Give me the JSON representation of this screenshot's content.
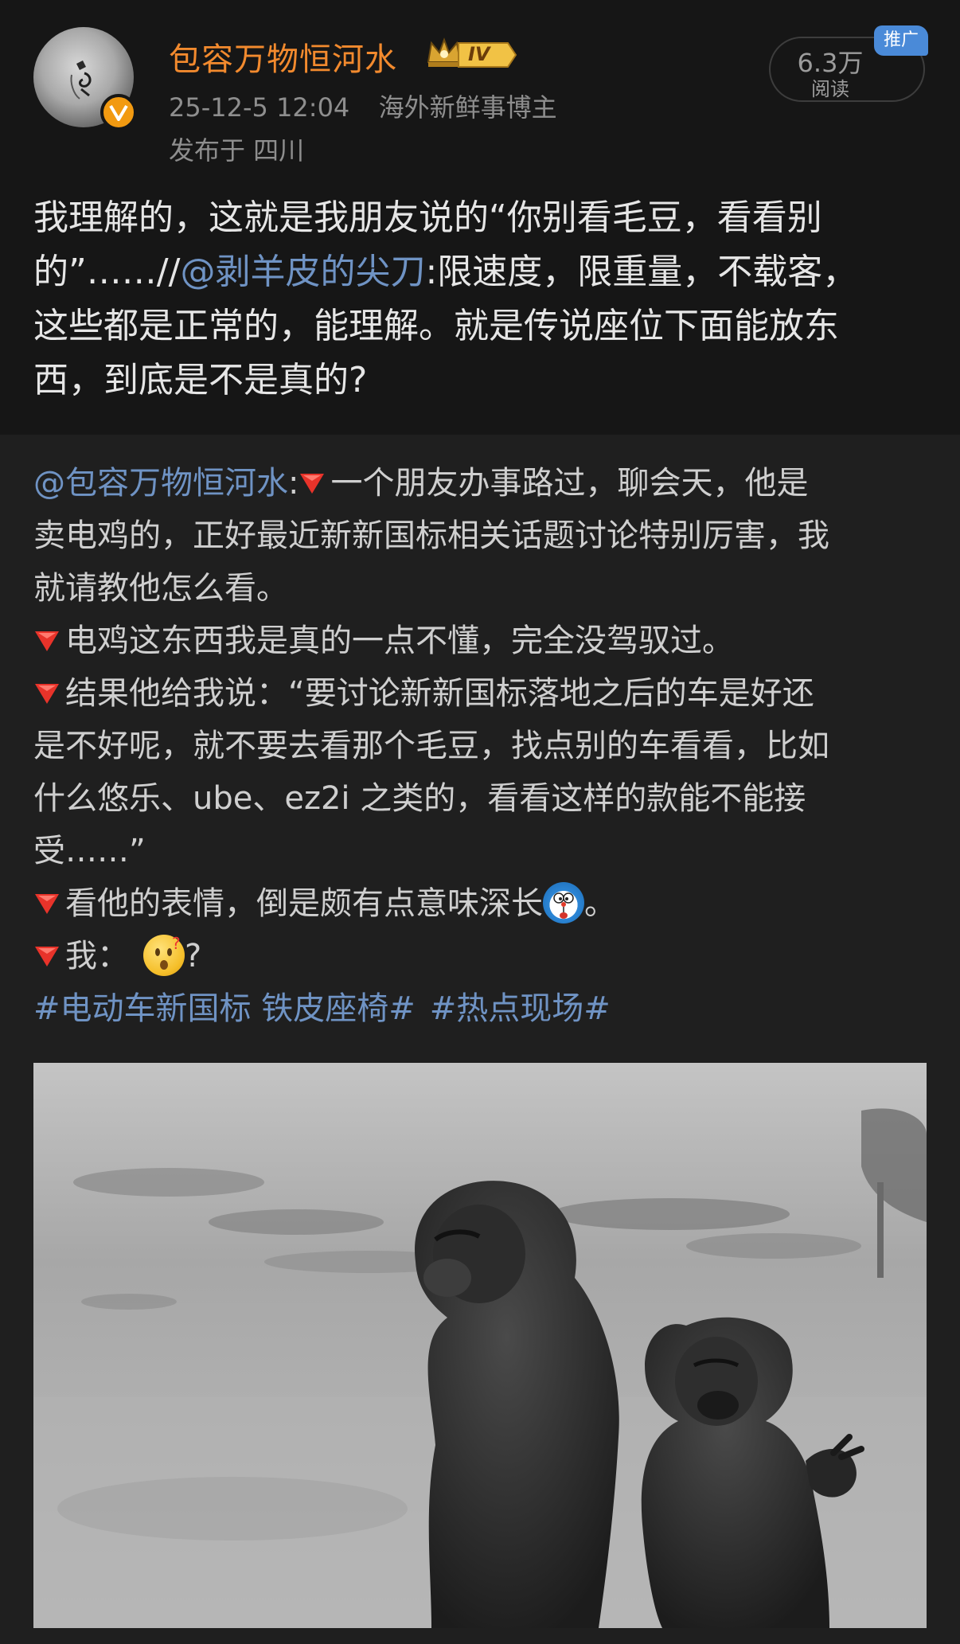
{
  "header": {
    "username": "包容万物恒河水",
    "level_badge": "IV",
    "timestamp": "25-12-5 12:04",
    "author_tag": "海外新鲜事博主",
    "location": "发布于 四川",
    "read_count": "6.3万",
    "read_label": "阅读",
    "ad_tag": "推广"
  },
  "post": {
    "line1": "我理解的，这就是我朋友说的“你别看毛豆，看看别",
    "line2_prefix": "的”……//",
    "line2_mention": "@剥羊皮的尖刀",
    "line2_suffix": ":限速度，限重量，不载客，",
    "line3": "这些都是正常的，能理解。就是传说座位下面能放东",
    "line4": "西，到底是不是真的?"
  },
  "repost": {
    "mention": "@包容万物恒河水",
    "colon": ":",
    "line1_text": "一个朋友办事路过，聊会天，他是",
    "line2": "卖电鸡的，正好最近新新国标相关话题讨论特别厉害，我",
    "line3": "就请教他怎么看。",
    "line4": "电鸡这东西我是真的一点不懂，完全没驾驭过。",
    "line5": "结果他给我说：“要讨论新新国标落地之后的车是好还",
    "line6": "是不好呢，就不要去看那个毛豆，找点别的车看看，比如",
    "line7": "什么悠乐、ube、ez2i 之类的，看看这样的款能不能接",
    "line8": "受……”",
    "line9_text": "看他的表情，倒是颇有点意味深长",
    "line9_end": "。",
    "line10_text": "我：",
    "line10_end": "?",
    "hashtag1": "#电动车新国标 铁皮座椅#",
    "hashtag2": "#热点现场#",
    "emoji_shrug": "doraemon-emoji",
    "emoji_face": "surprised-face-emoji"
  },
  "colors": {
    "username": "#f28a2e",
    "link": "#6f93c4",
    "badge": "#4a8ad8",
    "triangle": "#e8332a"
  }
}
